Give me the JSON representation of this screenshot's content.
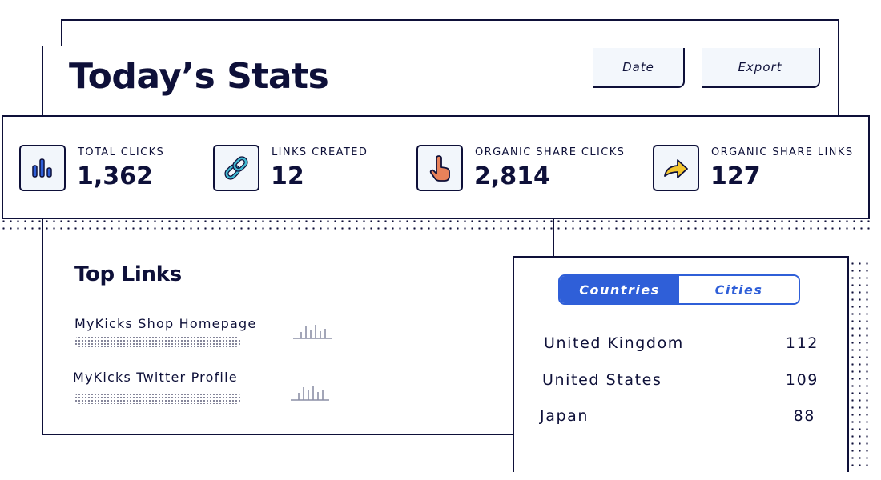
{
  "header": {
    "title": "Today’s Stats",
    "date_button": "Date",
    "export_button": "Export"
  },
  "stats": [
    {
      "label": "TOTAL CLICKS",
      "value": "1,362",
      "icon": "bar-chart-icon"
    },
    {
      "label": "LINKS CREATED",
      "value": "12",
      "icon": "link-icon"
    },
    {
      "label": "ORGANIC SHARE CLICKS",
      "value": "2,814",
      "icon": "tap-hand-icon"
    },
    {
      "label": "ORGANIC SHARE LINKS",
      "value": "127",
      "icon": "share-arrow-icon"
    }
  ],
  "top_links": {
    "title": "Top Links",
    "items": [
      {
        "name": "MyKicks Shop Homepage"
      },
      {
        "name": "MyKicks Twitter Profile"
      }
    ]
  },
  "geo": {
    "tabs": [
      "Countries",
      "Cities"
    ],
    "active_tab": "Countries",
    "rows": [
      {
        "name": "United Kingdom",
        "count": "112"
      },
      {
        "name": "United States",
        "count": "109"
      },
      {
        "name": "Japan",
        "count": "88"
      }
    ]
  },
  "colors": {
    "ink": "#0e1039",
    "accent": "#2f5fd8",
    "icon_bg": "#f2f6fb",
    "chart_blue": "#2f5fd8",
    "link_teal": "#3fb6cf",
    "hand_orange": "#e8825a",
    "arrow_yellow": "#f3c52e"
  }
}
